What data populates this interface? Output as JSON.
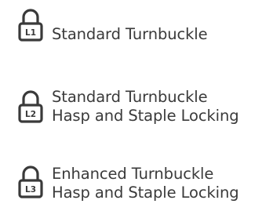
{
  "legend": {
    "items": [
      {
        "code": "L1",
        "icon": "padlock-icon",
        "lines": [
          "Standard Turnbuckle"
        ]
      },
      {
        "code": "L2",
        "icon": "padlock-icon",
        "lines": [
          "Standard Turnbuckle",
          "Hasp and Staple Locking"
        ]
      },
      {
        "code": "L3",
        "icon": "padlock-icon",
        "lines": [
          "Enhanced Turnbuckle",
          "Hasp and Staple Locking"
        ]
      }
    ],
    "colors": {
      "icon": "#3a3a3a",
      "text": "#3a3a3a",
      "background": "#ffffff"
    }
  }
}
